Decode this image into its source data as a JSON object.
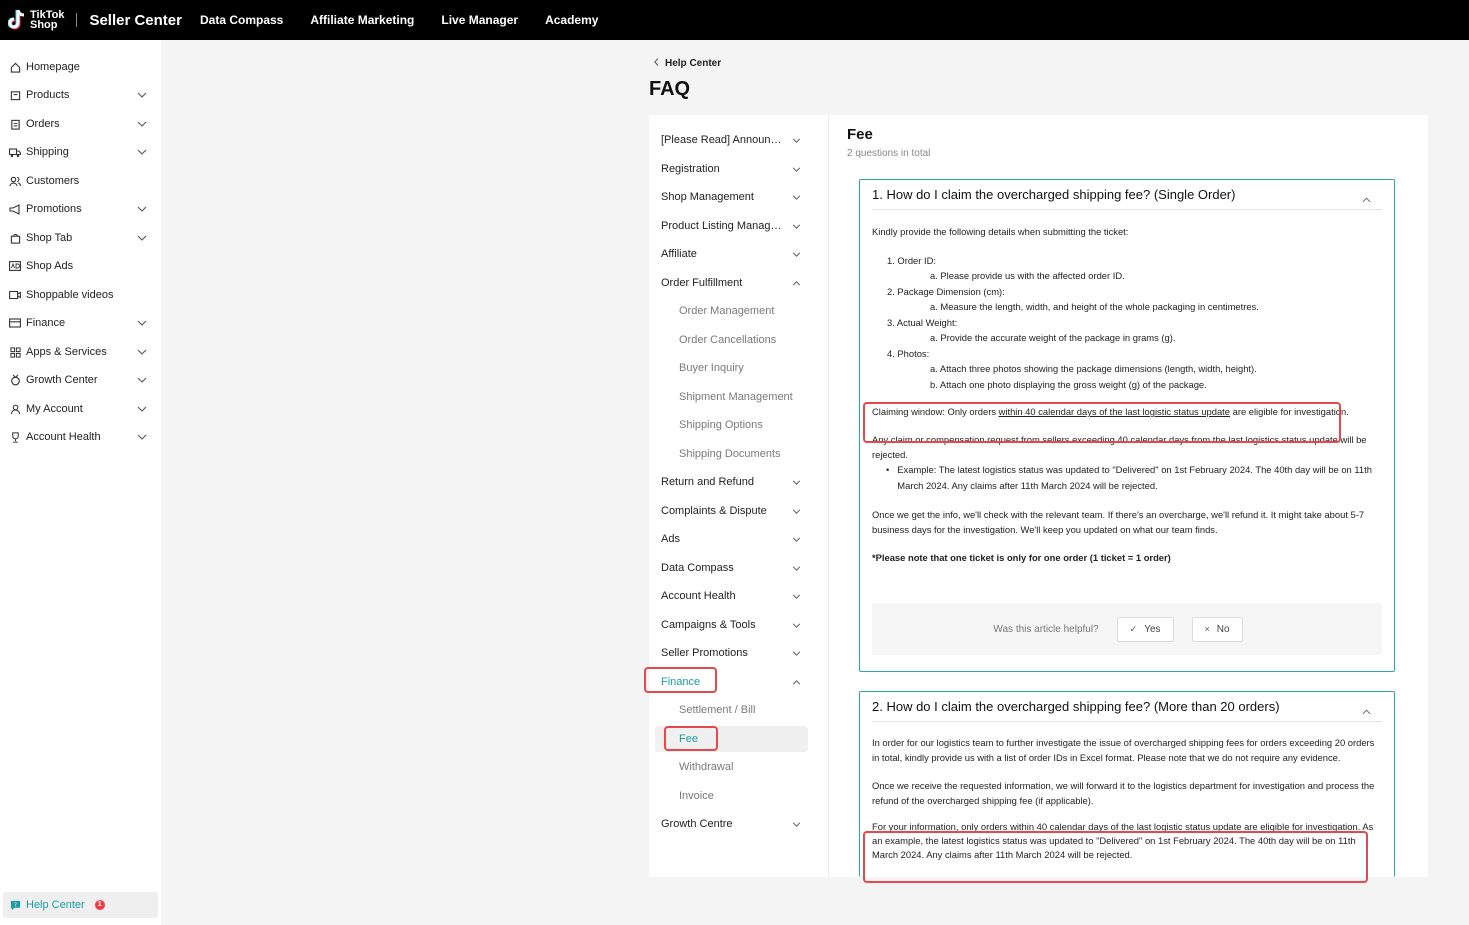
{
  "topbar": {
    "logo_line1": "TikTok",
    "logo_line2": "Shop",
    "app_title": "Seller Center",
    "nav": [
      "Data Compass",
      "Affiliate Marketing",
      "Live Manager",
      "Academy"
    ]
  },
  "sidebar": {
    "items": [
      {
        "label": "Homepage",
        "icon": "home-icon",
        "expandable": false
      },
      {
        "label": "Products",
        "icon": "box-icon",
        "expandable": true
      },
      {
        "label": "Orders",
        "icon": "clipboard-icon",
        "expandable": true
      },
      {
        "label": "Shipping",
        "icon": "truck-icon",
        "expandable": true
      },
      {
        "label": "Customers",
        "icon": "people-icon",
        "expandable": false
      },
      {
        "label": "Promotions",
        "icon": "megaphone-icon",
        "expandable": true
      },
      {
        "label": "Shop Tab",
        "icon": "shopping-bag-icon",
        "expandable": true
      },
      {
        "label": "Shop Ads",
        "icon": "ads-icon",
        "expandable": false
      },
      {
        "label": "Shoppable videos",
        "icon": "video-icon",
        "expandable": false
      },
      {
        "label": "Finance",
        "icon": "wallet-icon",
        "expandable": true
      },
      {
        "label": "Apps & Services",
        "icon": "grid-icon",
        "expandable": true
      },
      {
        "label": "Growth Center",
        "icon": "medal-icon",
        "expandable": true
      },
      {
        "label": "My Account",
        "icon": "user-icon",
        "expandable": true
      },
      {
        "label": "Account Health",
        "icon": "trophy-icon",
        "expandable": true
      }
    ],
    "help_center": {
      "label": "Help Center",
      "badge": "1"
    }
  },
  "header": {
    "back_label": "Help Center",
    "page_title": "FAQ"
  },
  "categories": [
    {
      "label": "[Please Read] Announc...",
      "expanded": false
    },
    {
      "label": "Registration",
      "expanded": false
    },
    {
      "label": "Shop Management",
      "expanded": false
    },
    {
      "label": "Product Listing Manage...",
      "expanded": false
    },
    {
      "label": "Affiliate",
      "expanded": false
    },
    {
      "label": "Order Fulfillment",
      "expanded": true
    },
    {
      "label": "Return and Refund",
      "expanded": false
    },
    {
      "label": "Complaints & Dispute",
      "expanded": false
    },
    {
      "label": "Ads",
      "expanded": false
    },
    {
      "label": "Data Compass",
      "expanded": false
    },
    {
      "label": "Account Health",
      "expanded": false
    },
    {
      "label": "Campaigns & Tools",
      "expanded": false
    },
    {
      "label": "Seller Promotions",
      "expanded": false
    },
    {
      "label": "Finance",
      "expanded": true,
      "active": true
    },
    {
      "label": "Growth Centre",
      "expanded": false
    }
  ],
  "order_fulfillment_sub": [
    "Order Management",
    "Order Cancellations",
    "Buyer Inquiry",
    "Shipment Management",
    "Shipping Options",
    "Shipping Documents"
  ],
  "finance_sub": [
    "Settlement / Bill",
    "Fee",
    "Withdrawal",
    "Invoice"
  ],
  "active_sub": "Fee",
  "section": {
    "title": "Fee",
    "count": "2 questions in total"
  },
  "q1": {
    "title": "1. How do I claim the overcharged shipping fee? (Single Order)",
    "intro": "Kindly provide the following details when submitting the ticket:",
    "list": [
      {
        "n": "1. Order ID:",
        "subs": [
          "a. Please provide us with the affected order ID."
        ]
      },
      {
        "n": "2. Package Dimension (cm):",
        "subs": [
          "a. Measure the length, width, and height of the whole packaging in centimetres."
        ]
      },
      {
        "n": "3. Actual Weight:",
        "subs": [
          "a. Provide the accurate weight of the package in grams (g)."
        ]
      },
      {
        "n": "4. Photos:",
        "subs": [
          "a. Attach three photos showing the package dimensions (length, width, height).",
          "b. Attach one photo displaying the gross weight (g) of the package."
        ]
      }
    ],
    "window_pre": "Claiming window: Only orders ",
    "window_link": "within 40 calendar days of the last logistic status update",
    "window_post": " are eligible for investigation.",
    "reject": "Any claim or compensation request from sellers exceeding 40 calendar days from the last logistics status update will be rejected.",
    "example": "Example: The latest logistics status was updated to \"Delivered\" on 1st February 2024. The 40th day will be on 11th March 2024. Any claims after 11th March 2024 will be rejected.",
    "followup": "Once we get the info, we'll check with the relevant team. If there's an overcharge, we'll refund it. It might take about 5-7 business days for the investigation. We'll keep you updated on what our team finds.",
    "note": "*Please note that one ticket is only for one order (1 ticket = 1 order)",
    "helpful_q": "Was this article helpful?",
    "yes": "Yes",
    "no": "No"
  },
  "q2": {
    "title": "2. How do I claim the overcharged shipping fee? (More than 20 orders)",
    "p1": "In order for our logistics team to further investigate the issue of overcharged shipping fees for orders exceeding 20 orders in total, kindly provide us with a list of order IDs in Excel format. Please note that we do not require any evidence.",
    "p2": "Once we receive the requested information, we will forward it to the logistics department for investigation and process the refund of the overcharged shipping fee (if applicable).",
    "p3_pre": "For your information, only orders ",
    "p3_link": "within 40 calendar days of the last logistic status update",
    "p3_post": " are eligible for investigation. As an example, the latest logistics status was updated to \"Delivered\" on 1st February 2024. The 40th day will be on 11th March 2024. Any claims after 11th March 2024 will be rejected."
  },
  "colors": {
    "accent": "#1a9ea0",
    "highlight": "#e5484d",
    "topbar": "#000000"
  }
}
